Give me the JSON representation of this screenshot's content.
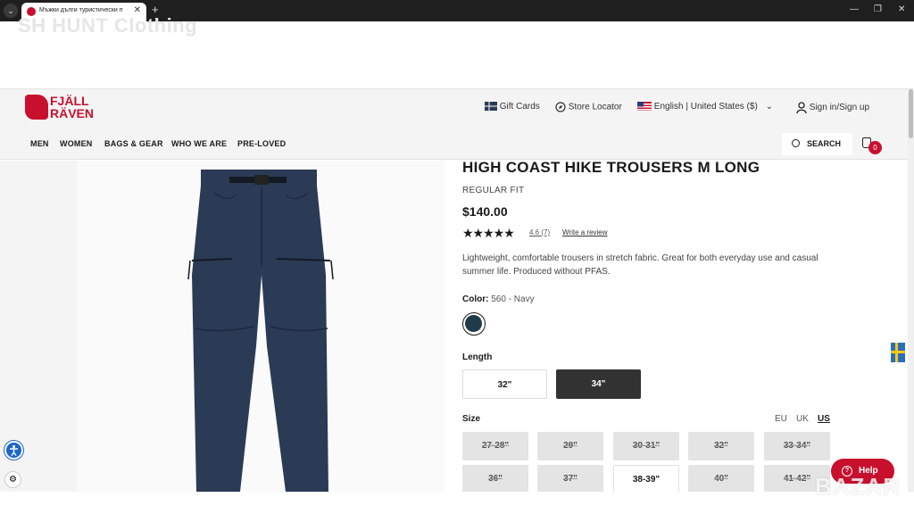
{
  "browser": {
    "tab_title": "Мъжки дълги туристически п",
    "tab_close": "✕",
    "new_tab": "+",
    "menu_glyph": "⌄",
    "controls": [
      "—",
      "❐",
      "✕"
    ]
  },
  "site_brand": "SH HUNT Clothing",
  "header": {
    "logo_line1": "FJÄLL",
    "logo_line2": "RÄVEN",
    "gift_cards": "Gift Cards",
    "store_locator": "Store Locator",
    "language": "English | United States ($)",
    "signin": "Sign in/Sign up",
    "nav": [
      "MEN",
      "WOMEN",
      "BAGS & GEAR",
      "WHO WE ARE",
      "PRE-LOVED"
    ],
    "search": "SEARCH",
    "cart_count": "0"
  },
  "product": {
    "title": "HIGH COAST HIKE TROUSERS M LONG",
    "fit": "REGULAR FIT",
    "price": "$140.00",
    "stars": "★★★★★",
    "rating": "4.6 (7)",
    "review_link": "Write a review",
    "description": "Lightweight, comfortable trousers in stretch fabric. Great for both everyday use and casual summer life. Produced without PFAS.",
    "color_label": "Color:",
    "color_value": "560 - Navy",
    "color_swatch": "#1f3b4a",
    "length_label": "Length",
    "lengths": [
      "32\"",
      "34\""
    ],
    "selected_length": "34\"",
    "size_label": "Size",
    "units": [
      "EU",
      "UK",
      "US"
    ],
    "selected_unit": "US",
    "sizes": [
      "27-28\"",
      "29\"",
      "30-31\"",
      "32\"",
      "33-34\"",
      "36\"",
      "37\"",
      "38-39\"",
      "40\"",
      "41-42\""
    ],
    "available_size": "38-39\""
  },
  "widgets": {
    "help": "Help",
    "cookie_glyph": "⚙",
    "watermark": "BAZAR"
  },
  "colors": {
    "brand_red": "#c8102e",
    "navy": "#2b3a55",
    "dark_button": "#323232"
  }
}
